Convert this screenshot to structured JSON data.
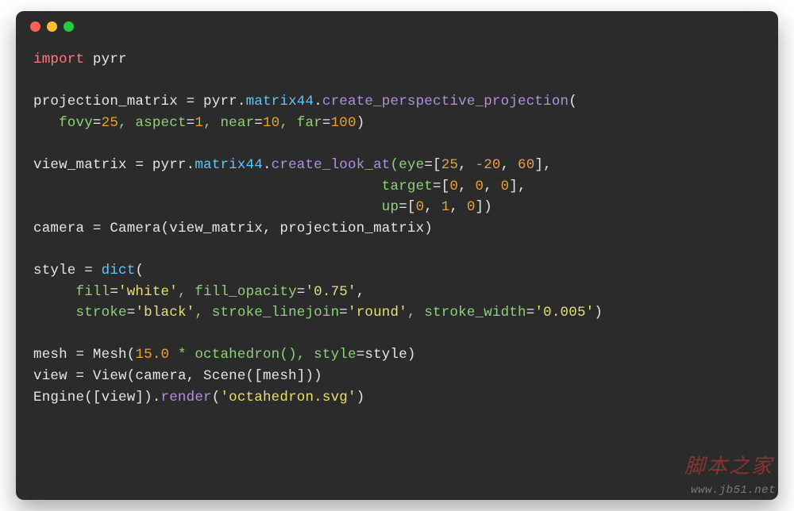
{
  "window": {
    "dots": [
      "red",
      "yellow",
      "green"
    ]
  },
  "code": {
    "l1": {
      "kw": "import",
      "sp": " ",
      "mod": "pyrr"
    },
    "l3a": "projection_matrix ",
    "l3b": "=",
    "l3c": " pyrr.",
    "l3d": "matrix44",
    "l3e": ".",
    "l3f": "create_perspective_projection",
    "l3g": "(",
    "l4a": "   fovy",
    "l4eq": "=",
    "l4v1": "25",
    "l4c1": ", aspect",
    "l4v2": "1",
    "l4c2": ", near",
    "l4v3": "10",
    "l4c3": ", far",
    "l4v4": "100",
    "l4end": ")",
    "l6a": "view_matrix ",
    "l6b": "=",
    "l6c": " pyrr.",
    "l6d": "matrix44",
    "l6e": ".",
    "l6f": "create_look_at",
    "l6g": "(eye",
    "l6h": "=[",
    "l6v1": "25",
    "l6s1": ", ",
    "l6v2": "-20",
    "l6s2": ", ",
    "l6v3": "60",
    "l6end": "],",
    "l7pad": "                                         target",
    "l7eq": "=[",
    "l7v1": "0",
    "l7s": ", ",
    "l7v2": "0",
    "l7v3": "0",
    "l7end": "],",
    "l8pad": "                                         up",
    "l8eq": "=[",
    "l8v1": "0",
    "l8v2": "1",
    "l8v3": "0",
    "l8end": "])",
    "l9a": "camera ",
    "l9b": "=",
    "l9c": " Camera(view_matrix, projection_matrix)",
    "l11a": "style ",
    "l11b": "=",
    "l11c": " ",
    "l11d": "dict",
    "l11e": "(",
    "l12a": "     fill",
    "l12eq": "=",
    "l12s1": "'white'",
    "l12c1": ", fill_opacity",
    "l12s2": "'0.75'",
    "l12end": ",",
    "l13a": "     stroke",
    "l13s1": "'black'",
    "l13c1": ", stroke_linejoin",
    "l13s2": "'round'",
    "l13c2": ", stroke_width",
    "l13s3": "'0.005'",
    "l13end": ")",
    "l15a": "mesh ",
    "l15b": "=",
    "l15c": " Mesh(",
    "l15n": "15.0",
    "l15d": " * octahedron(), style",
    "l15e": "=",
    "l15f": "style)",
    "l16a": "view ",
    "l16b": "=",
    "l16c": " View(camera, Scene([mesh]))",
    "l17a": "Engine([view]).",
    "l17b": "render",
    "l17c": "(",
    "l17s": "'octahedron.svg'",
    "l17end": ")"
  },
  "watermark": {
    "top": "脚本之家",
    "bot": "www.jb51.net"
  }
}
